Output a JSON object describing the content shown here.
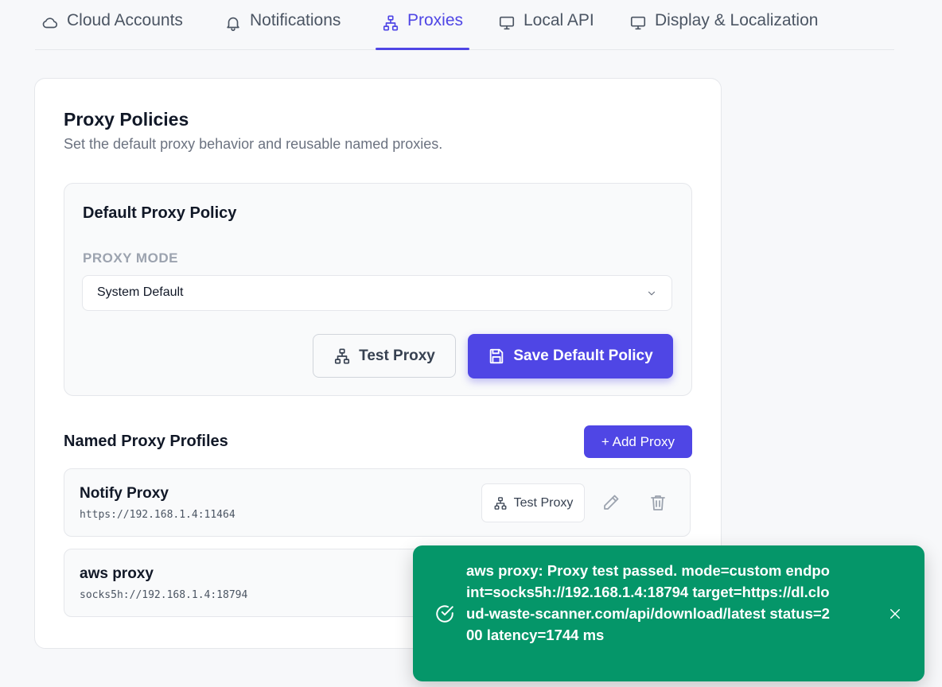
{
  "tabs": [
    {
      "label": "Cloud Accounts",
      "icon": "cloud-icon"
    },
    {
      "label": "Notifications",
      "icon": "bell-icon"
    },
    {
      "label": "Proxies",
      "icon": "network-icon"
    },
    {
      "label": "Local API",
      "icon": "monitor-icon"
    },
    {
      "label": "Display & Localization",
      "icon": "monitor-icon"
    }
  ],
  "active_tab": "Proxies",
  "card": {
    "title": "Proxy Policies",
    "subtitle": "Set the default proxy behavior and reusable named proxies."
  },
  "policy": {
    "title": "Default Proxy Policy",
    "mode_label": "PROXY MODE",
    "mode_value": "System Default",
    "test_label": "Test Proxy",
    "save_label": "Save Default Policy"
  },
  "profiles": {
    "title": "Named Proxy Profiles",
    "add_label": "+ Add Proxy",
    "items": [
      {
        "name": "Notify Proxy",
        "url": "https://192.168.1.4:11464",
        "test_label": "Test Proxy"
      },
      {
        "name": "aws proxy",
        "url": "socks5h://192.168.1.4:18794"
      }
    ]
  },
  "toast": {
    "message": "aws proxy: Proxy test passed. mode=custom endpoint=socks5h://192.168.1.4:18794 target=https://dl.cloud-waste-scanner.com/api/download/latest status=200 latency=1744 ms"
  },
  "colors": {
    "accent": "#4f46e5",
    "success": "#059669"
  }
}
